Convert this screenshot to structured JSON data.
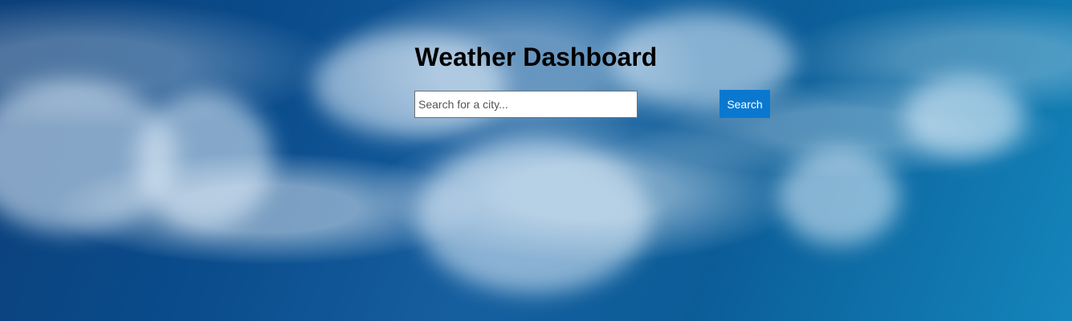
{
  "header": {
    "title": "Weather Dashboard"
  },
  "search": {
    "placeholder": "Search for a city...",
    "button_label": "Search"
  },
  "theme": {
    "accent": "#0b78d0",
    "background": "#0a4c8c"
  }
}
